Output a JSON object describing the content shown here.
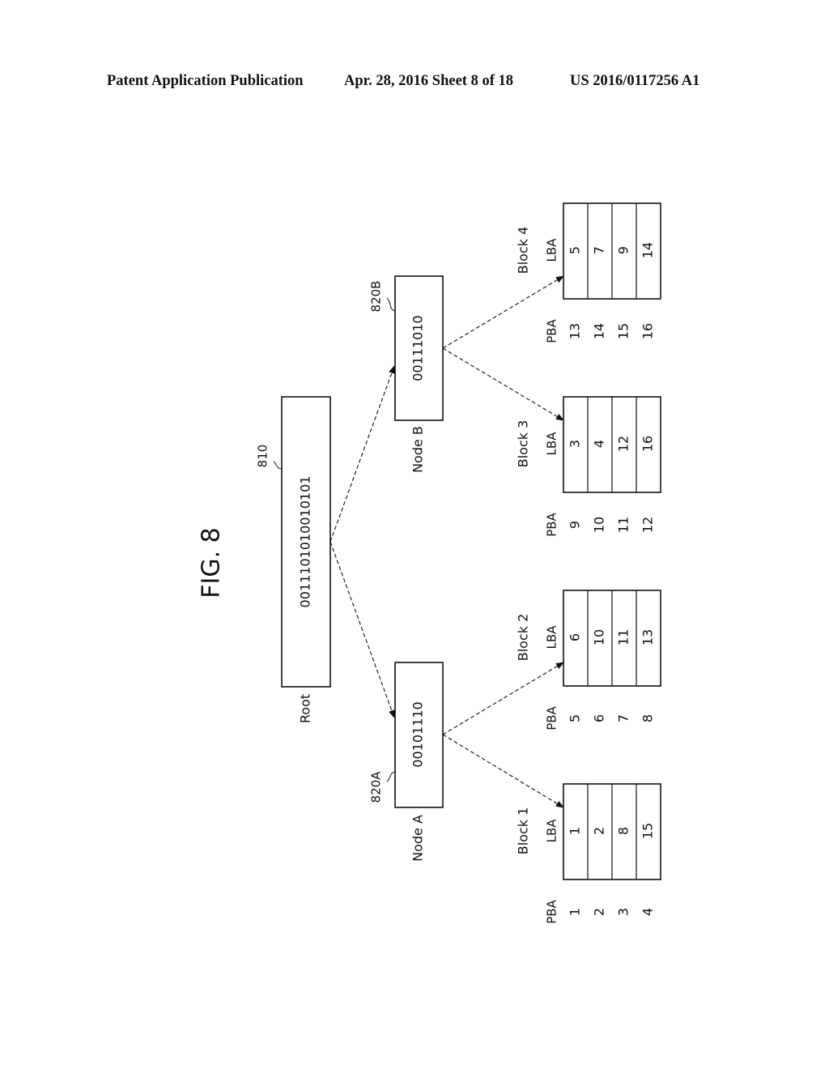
{
  "header": {
    "publication": "Patent Application Publication",
    "date_sheet": "Apr. 28, 2016  Sheet 8 of 18",
    "number": "US 2016/0117256 A1"
  },
  "figure": {
    "title": "FIG. 8",
    "root": {
      "label": "Root",
      "ref": "810",
      "bits": "0011101010010101"
    },
    "nodes": [
      {
        "label": "Node A",
        "ref": "820A",
        "bits": "00101110"
      },
      {
        "label": "Node B",
        "ref": "820B",
        "bits": "00111010"
      }
    ],
    "column_headers": {
      "pba": "PBA",
      "lba": "LBA"
    },
    "blocks": [
      {
        "label": "Block 1",
        "pba": [
          "1",
          "2",
          "3",
          "4"
        ],
        "lba": [
          "1",
          "2",
          "8",
          "15"
        ]
      },
      {
        "label": "Block 2",
        "pba": [
          "5",
          "6",
          "7",
          "8"
        ],
        "lba": [
          "6",
          "10",
          "11",
          "13"
        ]
      },
      {
        "label": "Block 3",
        "pba": [
          "9",
          "10",
          "11",
          "12"
        ],
        "lba": [
          "3",
          "4",
          "12",
          "16"
        ]
      },
      {
        "label": "Block 4",
        "pba": [
          "13",
          "14",
          "15",
          "16"
        ],
        "lba": [
          "5",
          "7",
          "9",
          "14"
        ]
      }
    ]
  }
}
